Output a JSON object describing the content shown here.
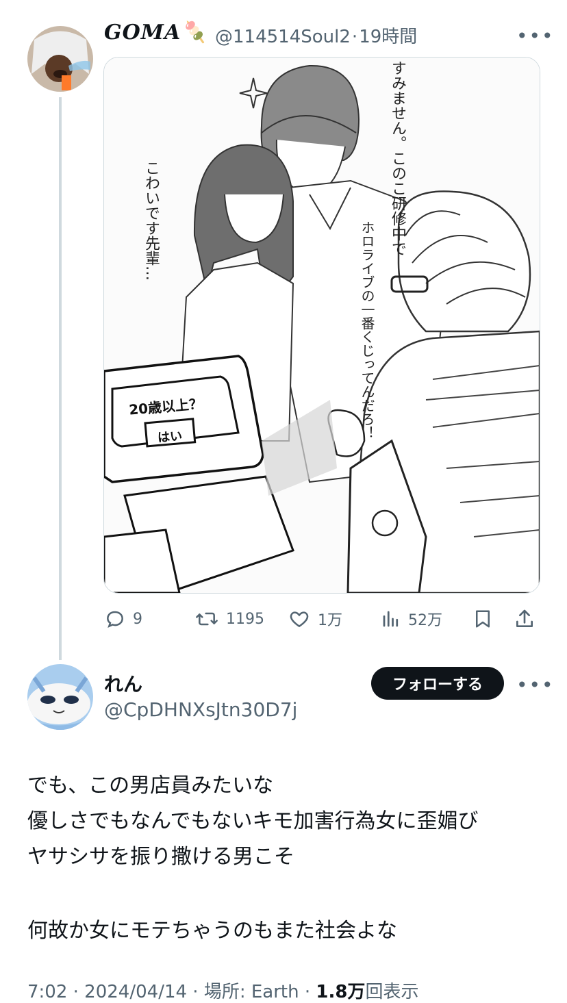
{
  "tweet": {
    "display_name": "GOMA🍡",
    "handle": "@114514Soul2",
    "separator": "·",
    "time": "19時間",
    "more_icon": "more-horizontal-icon",
    "image_text": {
      "right_speech": "すみません。このこ研修中で",
      "left_speech": "こわいです先輩…",
      "customer_speech": "ホロライブの一番くじってんだろ！",
      "screen_prompt": "20歳以上？",
      "screen_button": "はい"
    },
    "actions": {
      "replies": "9",
      "retweets": "1195",
      "likes": "1万",
      "views": "52万"
    }
  },
  "reply": {
    "display_name": "れん",
    "handle": "@CpDHNXsJtn30D7j",
    "follow_label": "フォローする",
    "body_lines": [
      "でも、この男店員みたいな",
      "優しさでもなんでもないキモ加害行為女に歪媚び",
      "ヤサシサを振り撒ける男こそ",
      "何故か女にモテちゃうのもまた社会よな"
    ],
    "footer": {
      "time_date": "7:02 · 2024/04/14 · 場所: Earth ·",
      "views_count": "1.8万",
      "views_label": "回表示"
    }
  },
  "colors": {
    "text": "#0f1419",
    "secondary": "#536471",
    "border": "#cfd9de",
    "follow_bg": "#0f1419"
  }
}
